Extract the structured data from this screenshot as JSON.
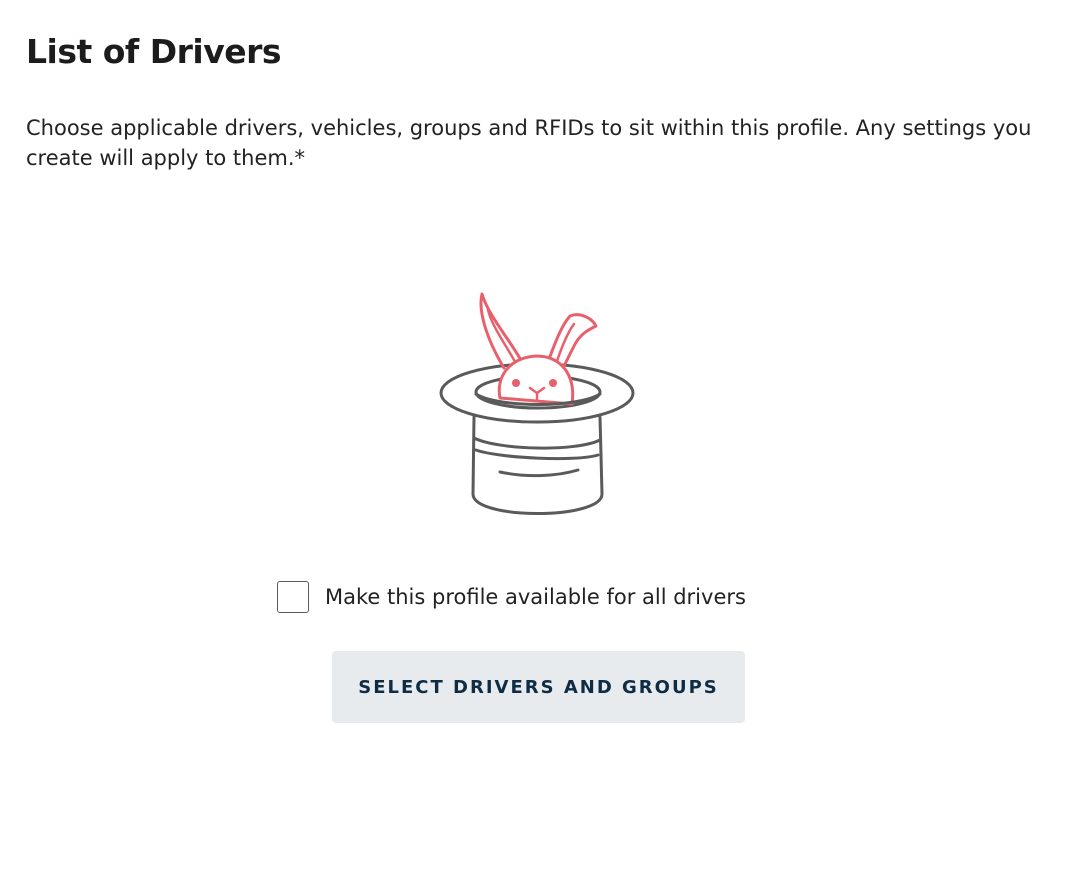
{
  "header": {
    "title": "List of Drivers"
  },
  "main": {
    "description": "Choose applicable drivers, vehicles, groups and RFIDs to sit within this profile. Any settings you create will apply to them.*",
    "illustration": {
      "icon": "rabbit-in-hat-icon",
      "colors": {
        "rabbit": "#e8606c",
        "hat": "#5a5a5a"
      }
    },
    "all_drivers_checkbox": {
      "label": "Make this profile available for all drivers",
      "checked": false
    },
    "select_button": {
      "label": "SELECT DRIVERS AND GROUPS",
      "background": "#e8ebee",
      "text_color": "#0f2c45"
    }
  }
}
